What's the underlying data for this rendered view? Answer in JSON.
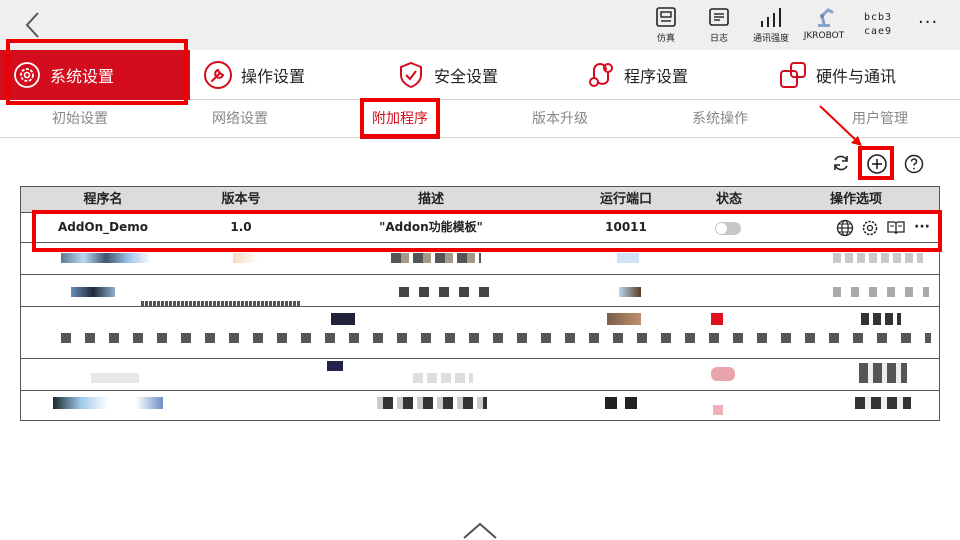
{
  "topbar": {
    "tools": [
      {
        "label": "仿真",
        "icon": "simulation-icon"
      },
      {
        "label": "日志",
        "icon": "log-icon"
      },
      {
        "label": "通讯强度",
        "icon": "signal-strength-icon"
      },
      {
        "label": "JKROBOT",
        "icon": "robot-arm-icon"
      }
    ],
    "id_line1": "bcb3",
    "id_line2": "cae9",
    "more": "···"
  },
  "main_tabs": [
    {
      "label": "系统设置",
      "icon": "gear-icon",
      "active": true
    },
    {
      "label": "操作设置",
      "icon": "wrench-icon"
    },
    {
      "label": "安全设置",
      "icon": "shield-icon"
    },
    {
      "label": "程序设置",
      "icon": "program-icon"
    },
    {
      "label": "硬件与通讯",
      "icon": "hardware-icon"
    }
  ],
  "sub_tabs": [
    "初始设置",
    "网络设置",
    "附加程序",
    "版本升级",
    "系统操作",
    "用户管理"
  ],
  "active_sub_tab": "附加程序",
  "table": {
    "headers": [
      "程序名",
      "版本号",
      "描述",
      "运行端口",
      "状态",
      "操作选项"
    ],
    "rows": [
      {
        "name": "AddOn_Demo",
        "version": "1.0",
        "description": "\"Addon功能模板\"",
        "port": "10011",
        "status": "off"
      }
    ],
    "row_icons": [
      "globe-icon",
      "gear-icon",
      "book-icon",
      "more-icon"
    ],
    "row_more": "···"
  },
  "colors": {
    "accent": "#d40d1e",
    "highlight": "#ee0000",
    "header_bg": "#dcdcdc"
  }
}
